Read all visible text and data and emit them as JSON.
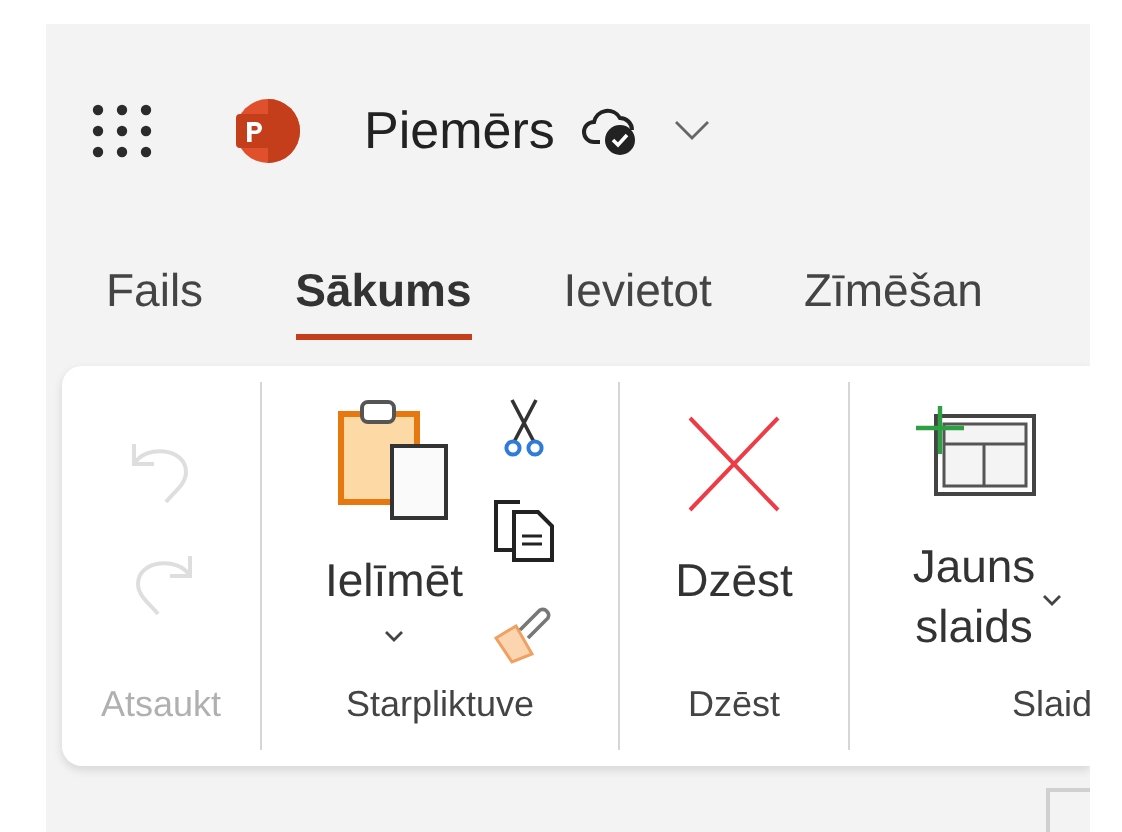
{
  "header": {
    "document_title": "Piemērs"
  },
  "tabs": [
    {
      "label": "Fails",
      "selected": false
    },
    {
      "label": "Sākums",
      "selected": true
    },
    {
      "label": "Ievietot",
      "selected": false
    },
    {
      "label": "Zīmēšan",
      "selected": false
    }
  ],
  "ribbon": {
    "groups": [
      {
        "label": "Atsaukt",
        "disabled": true,
        "kind": "stack",
        "buttons": [
          {
            "kind": "undo",
            "disabled": true
          },
          {
            "kind": "redo",
            "disabled": true
          }
        ]
      },
      {
        "label": "Starpliktuve",
        "disabled": false,
        "kind": "large-with-stack",
        "buttons": [
          {
            "kind": "paste",
            "label": "Ielīmēt",
            "disabled": false
          },
          {
            "kind": "cut",
            "disabled": false
          },
          {
            "kind": "copy",
            "disabled": false
          },
          {
            "kind": "format-painter",
            "disabled": false
          }
        ]
      },
      {
        "label": "Dzēst",
        "disabled": false,
        "kind": "large",
        "buttons": [
          {
            "kind": "delete",
            "label": "Dzēst",
            "disabled": false
          }
        ]
      },
      {
        "label": "Slaid",
        "disabled": false,
        "kind": "large",
        "buttons": [
          {
            "kind": "new-slide",
            "label": "Jauns slaids",
            "disabled": false
          }
        ]
      }
    ]
  }
}
